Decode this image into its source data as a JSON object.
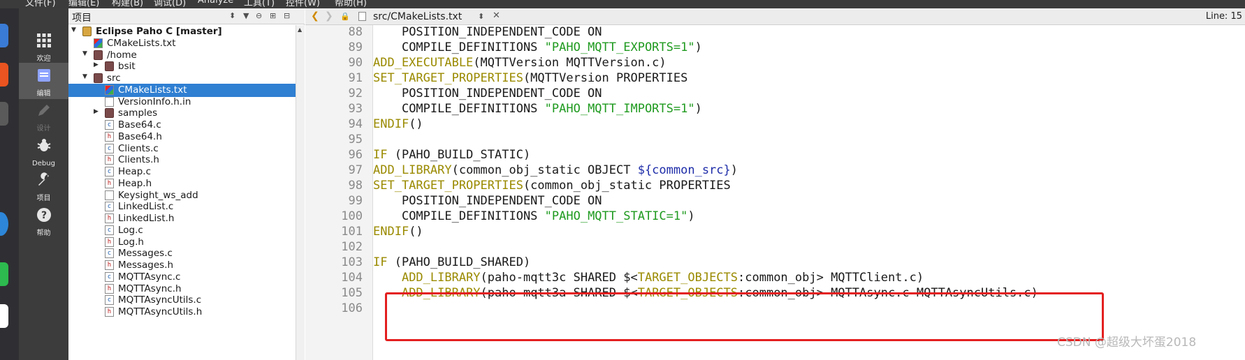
{
  "menubar": {
    "items": [
      "文件(F)",
      "编辑(E)",
      "构建(B)",
      "调试(D)",
      "Analyze",
      "工具(T)",
      "控件(W)",
      "帮助(H)"
    ]
  },
  "modes": [
    {
      "label": "欢迎",
      "icon": "grid-icon",
      "active": false
    },
    {
      "label": "编辑",
      "icon": "edit-doc-icon",
      "active": true
    },
    {
      "label": "设计",
      "icon": "pencil-icon",
      "active": false
    },
    {
      "label": "Debug",
      "icon": "bug-icon",
      "active": false
    },
    {
      "label": "项目",
      "icon": "wrench-icon",
      "active": false
    },
    {
      "label": "帮助",
      "icon": "help-icon",
      "active": false
    }
  ],
  "project": {
    "header_title": "项目",
    "tree": [
      {
        "label": "Eclipse Paho C [master]",
        "kind": "project",
        "arrow": "▼",
        "bold": true
      },
      {
        "label": "CMakeLists.txt",
        "kind": "cmake",
        "arrow": ""
      },
      {
        "label": "/home",
        "kind": "folder",
        "arrow": "▼"
      },
      {
        "label": "bsit",
        "kind": "folder",
        "arrow": "▶"
      },
      {
        "label": "src",
        "kind": "folder",
        "arrow": "▼"
      },
      {
        "label": "CMakeLists.txt",
        "kind": "cmake",
        "arrow": "",
        "selected": true
      },
      {
        "label": "VersionInfo.h.in",
        "kind": "text",
        "arrow": ""
      },
      {
        "label": "samples",
        "kind": "folder",
        "arrow": "▶"
      },
      {
        "label": "Base64.c",
        "kind": "c",
        "arrow": ""
      },
      {
        "label": "Base64.h",
        "kind": "h",
        "arrow": ""
      },
      {
        "label": "Clients.c",
        "kind": "c",
        "arrow": ""
      },
      {
        "label": "Clients.h",
        "kind": "h",
        "arrow": ""
      },
      {
        "label": "Heap.c",
        "kind": "c",
        "arrow": ""
      },
      {
        "label": "Heap.h",
        "kind": "h",
        "arrow": ""
      },
      {
        "label": "Keysight_ws_add",
        "kind": "text",
        "arrow": ""
      },
      {
        "label": "LinkedList.c",
        "kind": "c",
        "arrow": ""
      },
      {
        "label": "LinkedList.h",
        "kind": "h",
        "arrow": ""
      },
      {
        "label": "Log.c",
        "kind": "c",
        "arrow": ""
      },
      {
        "label": "Log.h",
        "kind": "h",
        "arrow": ""
      },
      {
        "label": "Messages.c",
        "kind": "c",
        "arrow": ""
      },
      {
        "label": "Messages.h",
        "kind": "h",
        "arrow": ""
      },
      {
        "label": "MQTTAsync.c",
        "kind": "c",
        "arrow": ""
      },
      {
        "label": "MQTTAsync.h",
        "kind": "h",
        "arrow": ""
      },
      {
        "label": "MQTTAsyncUtils.c",
        "kind": "c",
        "arrow": ""
      },
      {
        "label": "MQTTAsyncUtils.h",
        "kind": "h",
        "arrow": ""
      }
    ]
  },
  "editor": {
    "file_name": "src/CMakeLists.txt",
    "line_info": "Line: 15",
    "lines": [
      {
        "num": "88",
        "indent": "    ",
        "parts": [
          [
            "",
            "POSITION_INDEPENDENT_CODE ON"
          ]
        ]
      },
      {
        "num": "89",
        "indent": "    ",
        "parts": [
          [
            "",
            "COMPILE_DEFINITIONS "
          ],
          [
            "str",
            "\"PAHO_MQTT_EXPORTS=1\""
          ],
          [
            "",
            ")"
          ]
        ]
      },
      {
        "num": "90",
        "indent": "",
        "parts": [
          [
            "fn",
            "ADD_EXECUTABLE"
          ],
          [
            "",
            "(MQTTVersion MQTTVersion.c)"
          ]
        ]
      },
      {
        "num": "91",
        "indent": "",
        "parts": [
          [
            "fn",
            "SET_TARGET_PROPERTIES"
          ],
          [
            "",
            "(MQTTVersion PROPERTIES"
          ]
        ]
      },
      {
        "num": "92",
        "indent": "    ",
        "parts": [
          [
            "",
            "POSITION_INDEPENDENT_CODE ON"
          ]
        ]
      },
      {
        "num": "93",
        "indent": "    ",
        "parts": [
          [
            "",
            "COMPILE_DEFINITIONS "
          ],
          [
            "str",
            "\"PAHO_MQTT_IMPORTS=1\""
          ],
          [
            "",
            ")"
          ]
        ]
      },
      {
        "num": "94",
        "indent": "",
        "parts": [
          [
            "fn",
            "ENDIF"
          ],
          [
            "",
            "()"
          ]
        ]
      },
      {
        "num": "95",
        "indent": "",
        "parts": []
      },
      {
        "num": "96",
        "indent": "",
        "parts": [
          [
            "fn",
            "IF"
          ],
          [
            "",
            " (PAHO_BUILD_STATIC)"
          ]
        ]
      },
      {
        "num": "97",
        "indent": "",
        "parts": [
          [
            "fn",
            "ADD_LIBRARY"
          ],
          [
            "",
            "(common_obj_static OBJECT "
          ],
          [
            "var",
            "${common_src}"
          ],
          [
            "",
            ")"
          ]
        ]
      },
      {
        "num": "98",
        "indent": "",
        "parts": [
          [
            "fn",
            "SET_TARGET_PROPERTIES"
          ],
          [
            "",
            "(common_obj_static PROPERTIES"
          ]
        ]
      },
      {
        "num": "99",
        "indent": "    ",
        "parts": [
          [
            "",
            "POSITION_INDEPENDENT_CODE ON"
          ]
        ]
      },
      {
        "num": "100",
        "indent": "    ",
        "parts": [
          [
            "",
            "COMPILE_DEFINITIONS "
          ],
          [
            "str",
            "\"PAHO_MQTT_STATIC=1\""
          ],
          [
            "",
            ")"
          ]
        ]
      },
      {
        "num": "101",
        "indent": "",
        "parts": [
          [
            "fn",
            "ENDIF"
          ],
          [
            "",
            "()"
          ]
        ]
      },
      {
        "num": "102",
        "indent": "",
        "parts": []
      },
      {
        "num": "103",
        "indent": "",
        "parts": [
          [
            "fn",
            "IF"
          ],
          [
            "",
            " (PAHO_BUILD_SHARED)"
          ]
        ]
      },
      {
        "num": "104",
        "indent": "    ",
        "parts": [
          [
            "fn",
            "ADD_LIBRARY"
          ],
          [
            "",
            "(paho-mqtt3c SHARED $<"
          ],
          [
            "kw",
            "TARGET_OBJECTS"
          ],
          [
            "",
            ":common_obj> MQTTClient.c)"
          ]
        ]
      },
      {
        "num": "105",
        "indent": "    ",
        "parts": [
          [
            "fn",
            "ADD_LIBRARY"
          ],
          [
            "",
            "(paho-mqtt3a SHARED $<"
          ],
          [
            "kw",
            "TARGET_OBJECTS"
          ],
          [
            "",
            ":common_obj> MQTTAsync.c MQTTAsyncUtils.c)"
          ]
        ]
      },
      {
        "num": "106",
        "indent": "",
        "parts": []
      }
    ]
  },
  "watermark": "CSDN @超级大坏蛋2018",
  "colors": {
    "selection": "#2f7fd2",
    "annotation_box": "#e41f1f",
    "function": "#9a8a00",
    "string": "#1f9a1f",
    "variable": "#1e2da8"
  }
}
